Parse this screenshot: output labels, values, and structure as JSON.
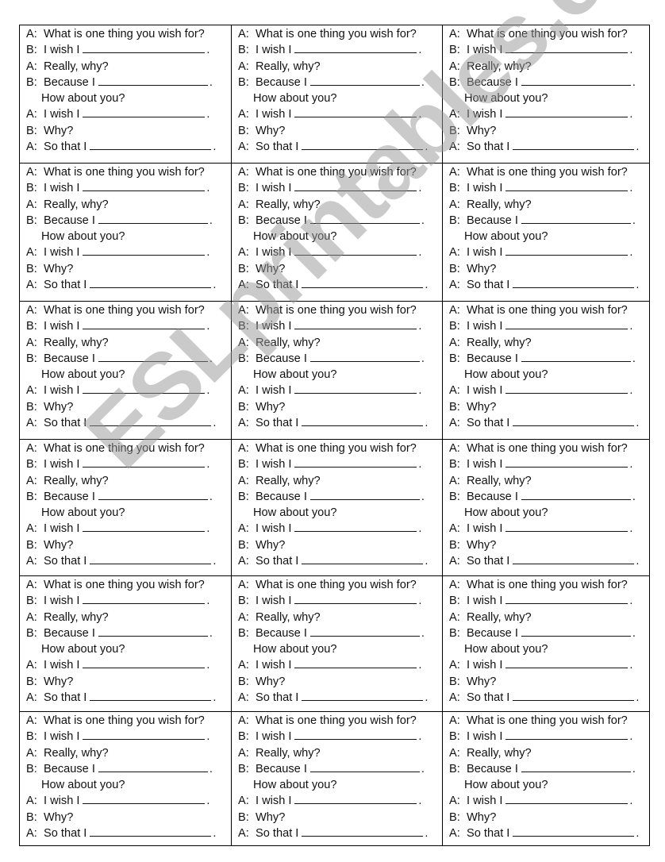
{
  "document": {
    "rows": 6,
    "columns": 3,
    "card": {
      "lines": [
        {
          "speaker": "A:",
          "text": "What is one thing you wish for?",
          "blank": false
        },
        {
          "speaker": "B:",
          "text": "I wish I",
          "blank": true,
          "end": "."
        },
        {
          "speaker": "A:",
          "text": "Really, why?",
          "blank": false
        },
        {
          "speaker": "B:",
          "text": "Because I",
          "blank": true,
          "end": "."
        },
        {
          "speaker": "",
          "text": "How about you?",
          "blank": false
        },
        {
          "speaker": "A:",
          "text": "I wish I",
          "blank": true,
          "end": "."
        },
        {
          "speaker": "B:",
          "text": "Why?",
          "blank": false
        },
        {
          "speaker": "A:",
          "text": "So that I",
          "blank": true,
          "end": "."
        }
      ]
    }
  },
  "watermark": {
    "text": "ESLprintables.com",
    "color": "#c8c8c8"
  }
}
